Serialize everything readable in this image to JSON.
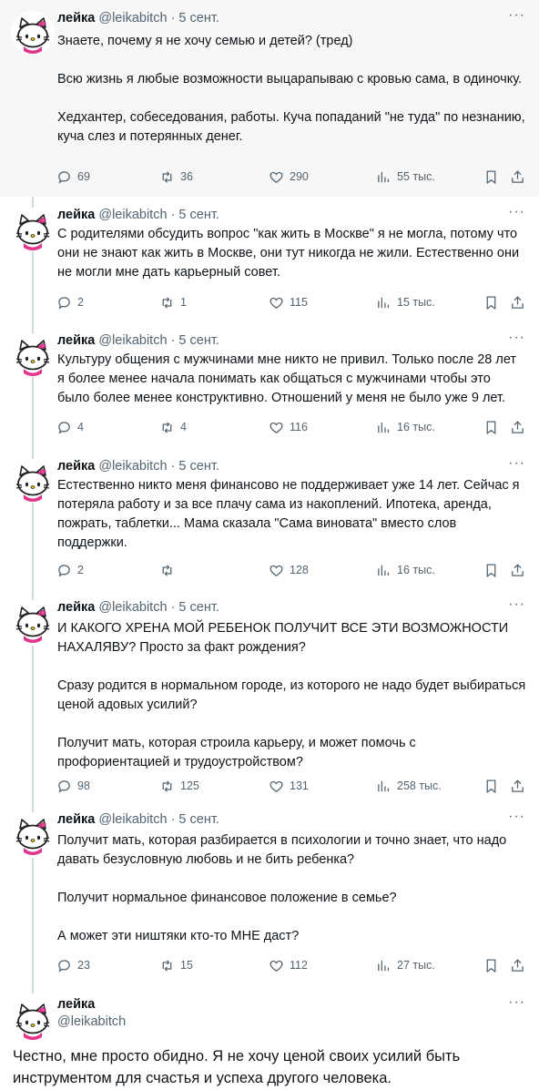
{
  "author": {
    "name": "лейка",
    "handle": "@leikabitch",
    "date_sep": "· 5 сент."
  },
  "tweets": [
    {
      "paragraphs": [
        "Знаете, почему я не хочу семью и детей? (тред)",
        "Всю жизнь я любые возможности выцарапываю с кровью сама, в одиночку.",
        "Хедхантер, собеседования, работы. Куча попаданий \"не туда\" по незнанию, куча слез и потерянных денег."
      ],
      "replies": "69",
      "retweets": "36",
      "likes": "290",
      "views": "55 тыс."
    },
    {
      "paragraphs": [
        "С родителями обсудить вопрос \"как жить в Москве\" я не могла, потому что они не знают как жить в Москве, они тут никогда не жили. Естественно они не могли мне дать карьерный совет."
      ],
      "replies": "2",
      "retweets": "1",
      "likes": "115",
      "views": "15 тыс."
    },
    {
      "paragraphs": [
        "Культуру общения с мужчинами мне никто не привил. Только после 28 лет я более менее начала понимать как общаться с мужчинами чтобы это было более менее конструктивно. Отношений у меня не было уже 9 лет."
      ],
      "replies": "4",
      "retweets": "4",
      "likes": "116",
      "views": "16 тыс."
    },
    {
      "paragraphs": [
        "Естественно никто меня финансово не поддерживает уже 14 лет. Сейчас я потеряла работу и за все плачу сама из накоплений. Ипотека, аренда, пожрать, таблетки... Мама сказала \"Сама виновата\" вместо слов поддержки."
      ],
      "replies": "2",
      "retweets": "",
      "likes": "128",
      "views": "16 тыс."
    },
    {
      "paragraphs": [
        "И КАКОГО ХРЕНА МОЙ РЕБЕНОК ПОЛУЧИТ ВСЕ ЭТИ ВОЗМОЖНОСТИ НАХАЛЯВУ? Просто за факт рождения?",
        "Сразу родится в нормальном городе, из которого не надо будет выбираться ценой адовых усилий?",
        "Получит мать, которая строила карьеру, и может помочь с профориентацией и трудоустройством?"
      ],
      "replies": "98",
      "retweets": "125",
      "likes": "131",
      "views": "258 тыс."
    },
    {
      "paragraphs": [
        "Получит мать, которая разбирается в психологии и точно знает, что надо давать безусловную любовь и не бить ребенка?",
        "Получит нормальное финансовое положение в семье?",
        "А может эти ништяки кто-то МНЕ даст?"
      ],
      "replies": "23",
      "retweets": "15",
      "likes": "112",
      "views": "27 тыс."
    }
  ],
  "final": {
    "name": "лейка",
    "handle": "@leikabitch",
    "text": "Честно, мне просто обидно. Я не хочу ценой своих усилий быть инструментом для счастья и успеха другого человека."
  },
  "icons": {
    "reply": "reply-icon",
    "retweet": "retweet-icon",
    "like": "heart-icon",
    "views": "views-icon",
    "bookmark": "bookmark-icon",
    "share": "share-icon",
    "more": "more-icon",
    "avatar": "hello-kitty-avatar"
  },
  "colors": {
    "text": "#0f1419",
    "muted": "#536471",
    "thread_line": "#cfd9de",
    "highlight_bg": "#f7f7f7",
    "avatar_bow": "#e0358a"
  }
}
